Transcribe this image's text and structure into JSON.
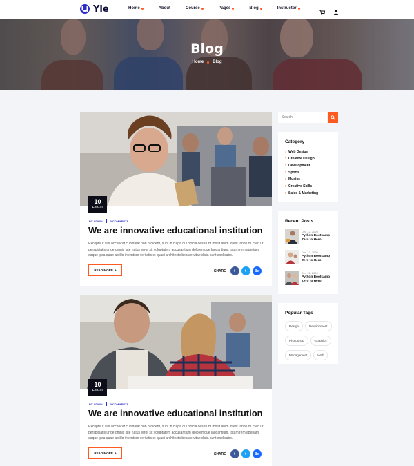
{
  "brand": {
    "name": "Yle",
    "accent": "#ff5a1f",
    "dark": "#0d0d1a",
    "link": "#2b2bc7"
  },
  "nav": [
    {
      "label": "Home",
      "dropdown": true
    },
    {
      "label": "About",
      "dropdown": false
    },
    {
      "label": "Course",
      "dropdown": true
    },
    {
      "label": "Pages",
      "dropdown": true
    },
    {
      "label": "Blog",
      "dropdown": true
    },
    {
      "label": "Instructor",
      "dropdown": true
    }
  ],
  "header_icons": [
    "cart-icon",
    "user-icon"
  ],
  "hero": {
    "title": "Blog",
    "breadcrumb": [
      "Home",
      "Blog"
    ]
  },
  "posts": [
    {
      "day": "10",
      "month": "Feb/20",
      "author": "BY ADMIN",
      "comments": "0 COMMENTS",
      "title": "We are innovative educational institution",
      "excerpt": "Excepteur sint occaecat cupidatat non proident, sunt in culpa qui officia deserunt mollit anim id est laborum. Sed ut perspiciatis unde omnis iste natus error sit voluptatem accusantium doloremque laudantium, totam rem aperiam, eaque ipsa quae ab illo inventore veritatis et quasi architecto beatae vitae dicta sunt explicabo.",
      "read_more": "READ MORE",
      "share_label": "SHARE"
    },
    {
      "day": "10",
      "month": "Feb/20",
      "author": "BY ADMIN",
      "comments": "0 COMMENTS",
      "title": "We are innovative educational institution",
      "excerpt": "Excepteur sint occaecat cupidatat non proident, sunt in culpa qui officia deserunt mollit anim id est laborum. Sed ut perspiciatis unde omnis iste natus error sit voluptatem accusantium doloremque laudantium, totam rem aperiam, eaque ipsa quae ab illo inventore veritatis et quasi architecto beatae vitae dicta sunt explicabo.",
      "read_more": "READ MORE",
      "share_label": "SHARE"
    }
  ],
  "social": [
    {
      "label": "f",
      "color": "#3b5998",
      "icon": "facebook-icon"
    },
    {
      "label": "t",
      "color": "#1da1f2",
      "icon": "twitter-icon"
    },
    {
      "label": "Be",
      "color": "#1769ff",
      "icon": "behance-icon"
    }
  ],
  "sidebar": {
    "search": {
      "placeholder": "Search"
    },
    "category": {
      "title": "Category",
      "items": [
        "Web Design",
        "Creative Design",
        "Development",
        "Sports",
        "Musics",
        "Creative Skills",
        "Sales & Marketing"
      ]
    },
    "recent_posts": {
      "title": "Recent Posts",
      "items": [
        {
          "date": "Dec 12, 2020",
          "title": "Python Bootcamp Zero to Hero"
        },
        {
          "date": "Dec 12, 2020",
          "title": "Python Bootcamp Zero to Hero"
        },
        {
          "date": "Dec 12, 2020",
          "title": "Python Bootcamp Zero to Hero"
        }
      ]
    },
    "tags": {
      "title": "Popular Tags",
      "items": [
        "Design",
        "Development",
        "Photoshop",
        "Graphics",
        "Management",
        "Web"
      ]
    }
  }
}
